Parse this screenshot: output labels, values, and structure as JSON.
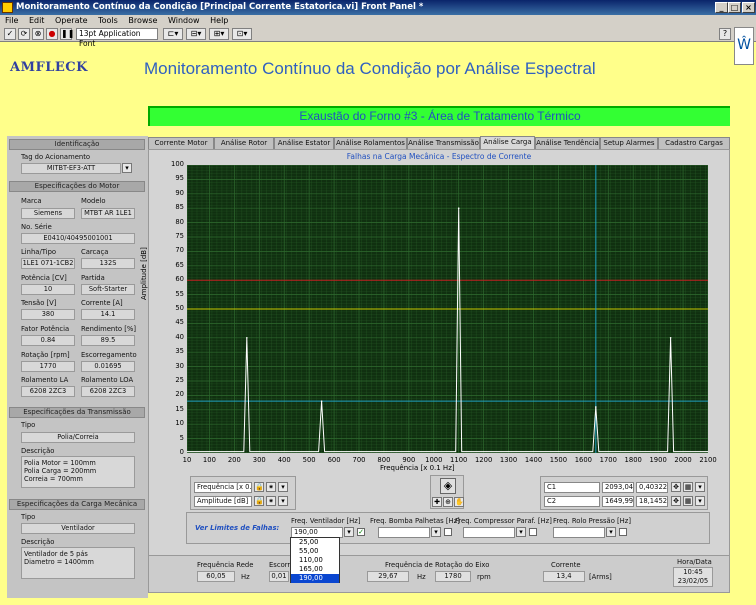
{
  "window": {
    "title": "Monitoramento Contínuo da Condição [Principal Corrente Estatorica.vi] Front Panel *"
  },
  "menu": [
    "File",
    "Edit",
    "Operate",
    "Tools",
    "Browse",
    "Window",
    "Help"
  ],
  "toolbar": {
    "font": "13pt Application Font"
  },
  "header": {
    "logo": "AMFLECK",
    "title": "Monitoramento Contínuo da Condição por Análise Espectral",
    "subtitle": "Exaustão do Forno #3 - Área de Tratamento Térmico"
  },
  "left": {
    "identificacao": {
      "heading": "Identificação",
      "tag_label": "Tag do Acionamento",
      "tag_value": "MITBT-EF3-ATT"
    },
    "motor": {
      "heading": "Especificações do Motor",
      "marca_label": "Marca",
      "marca": "Siemens",
      "modelo_label": "Modelo",
      "modelo": "MTBT AR 1LE1",
      "serie_label": "No. Série",
      "serie": "E0410/40495001001",
      "linha_label": "Linha/Tipo",
      "linha": "1LE1 071-1CB2",
      "carcaca_label": "Carcaça",
      "carcaca": "132S",
      "potencia_label": "Potência [CV]",
      "potencia": "10",
      "partida_label": "Partida",
      "partida": "Soft-Starter",
      "tensao_label": "Tensão [V]",
      "tensao": "380",
      "corrente_label": "Corrente [A]",
      "corrente": "14.1",
      "fp_label": "Fator Potência",
      "fp": "0.84",
      "rend_label": "Rendimento [%]",
      "rend": "89.5",
      "rot_label": "Rotação [rpm]",
      "rot": "1770",
      "esc_label": "Escorregamento",
      "esc": "0.01695",
      "rla_label": "Rolamento LA",
      "rla": "6208 2ZC3",
      "rloa_label": "Rolamento LOA",
      "rloa": "6208 2ZC3"
    },
    "transmissao": {
      "heading": "Especificações da Transmissão",
      "tipo_label": "Tipo",
      "tipo": "Polia/Correia",
      "desc_label": "Descrição",
      "desc": [
        "Polia Motor = 100mm",
        "Polia Carga = 200mm",
        "Correia = 700mm"
      ]
    },
    "carga": {
      "heading": "Especificações da Carga Mecânica",
      "tipo_label": "Tipo",
      "tipo": "Ventilador",
      "desc_label": "Descrição",
      "desc": [
        "Ventilador de 5 pás",
        "Diametro = 1400mm"
      ]
    }
  },
  "tabs": [
    "Corrente Motor",
    "Análise Rotor",
    "Análise Estator",
    "Análise Rolamentos",
    "Análise Transmissão",
    "Análise Carga",
    "Análise Tendência",
    "Setup Alarmes",
    "Cadastro Cargas"
  ],
  "active_tab": "Análise Carga",
  "chart_data": {
    "type": "line",
    "title": "Falhas na Carga Mecânica - Espectro de Corrente",
    "xlabel": "Frequência [x 0.1 Hz]",
    "ylabel": "Amplitude [dB]",
    "xlim": [
      10,
      2100
    ],
    "ylim": [
      0,
      100
    ],
    "xticks": [
      10,
      100,
      200,
      300,
      400,
      500,
      600,
      700,
      800,
      900,
      1000,
      1100,
      1200,
      1300,
      1400,
      1500,
      1600,
      1700,
      1800,
      1900,
      2000,
      2100
    ],
    "yticks": [
      0,
      5,
      10,
      15,
      20,
      25,
      30,
      35,
      40,
      45,
      50,
      55,
      60,
      65,
      70,
      75,
      80,
      85,
      90,
      95,
      100
    ],
    "grid": true,
    "series": [
      {
        "peaks": [
          {
            "x": 250,
            "y": 40
          },
          {
            "x": 550,
            "y": 18
          },
          {
            "x": 1100,
            "y": 85
          },
          {
            "x": 1650,
            "y": 16
          },
          {
            "x": 1950,
            "y": 40
          }
        ]
      }
    ],
    "limit_lines": [
      {
        "y": 60,
        "color": "#c02020"
      },
      {
        "y": 50,
        "color": "#c8c800"
      },
      {
        "y": 18,
        "color": "#20a0c0"
      }
    ],
    "cursor": {
      "x": 1650,
      "color": "#20a0c0"
    },
    "colors": {
      "background": "#103010",
      "grid": "#2f6a2f",
      "trace": "#ffffff"
    }
  },
  "cursor_panel": {
    "x_scale": "Frequência [x 0.1",
    "y_scale": "Amplitude [dB]",
    "c1_name": "C1",
    "c1_x": "2093,04",
    "c1_y": "0,403225",
    "c2_name": "C2",
    "c2_x": "1649,99",
    "c2_y": "18,1452"
  },
  "limits": {
    "ver": "Ver Limites de Falhas:",
    "vent_label": "Freq. Ventilador [Hz]",
    "vent_value": "190,00",
    "bomba_label": "Freq. Bomba Palhetas [Hz]",
    "comp_label": "Freq. Compressor Paraf. [Hz]",
    "rolo_label": "Freq. Rolo Pressão [Hz]",
    "options": [
      "25,00",
      "55,00",
      "110,00",
      "165,00",
      "190,00"
    ],
    "selected_index": 4
  },
  "bottom": {
    "freq_rede_label": "Frequência Rede",
    "freq_rede": "60,05",
    "hz": "Hz",
    "esc_label": "Escorre",
    "esc_value": "0,01",
    "rot_label": "Frequência de Rotação do Eixo",
    "rot_hz": "29,67",
    "rot_hz_unit": "Hz",
    "rot_rpm": "1780",
    "rpm": "rpm",
    "corr_label": "Corrente",
    "corr": "13,4",
    "arms": "[Arms]",
    "data_label": "Hora/Data",
    "hora": "10:45",
    "data": "23/02/05"
  }
}
